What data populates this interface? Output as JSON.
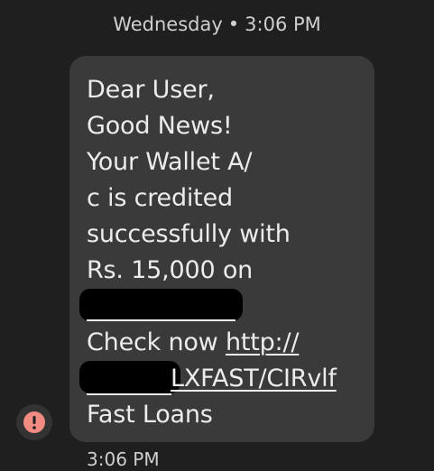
{
  "header": {
    "day": "Wednesday",
    "separator": "•",
    "time": "3:06 PM"
  },
  "message": {
    "line1": "Dear User,",
    "line2": "Good News!",
    "line3": "Your Wallet A/",
    "line4": "c is credited",
    "line5": "successfully with",
    "line6": "Rs. 15,000 on",
    "line8_text": "Check now ",
    "line8_link": "http://",
    "line9_link_tail": "LXFAST/CIRvlf",
    "line10": "Fast Loans"
  },
  "status": {
    "icon": "error-icon",
    "icon_color": "#f28b82",
    "timestamp": "3:06 PM"
  },
  "colors": {
    "background": "#1f1f1f",
    "bubble": "#3a3a3a",
    "text": "#ececec",
    "error": "#f28b82"
  }
}
